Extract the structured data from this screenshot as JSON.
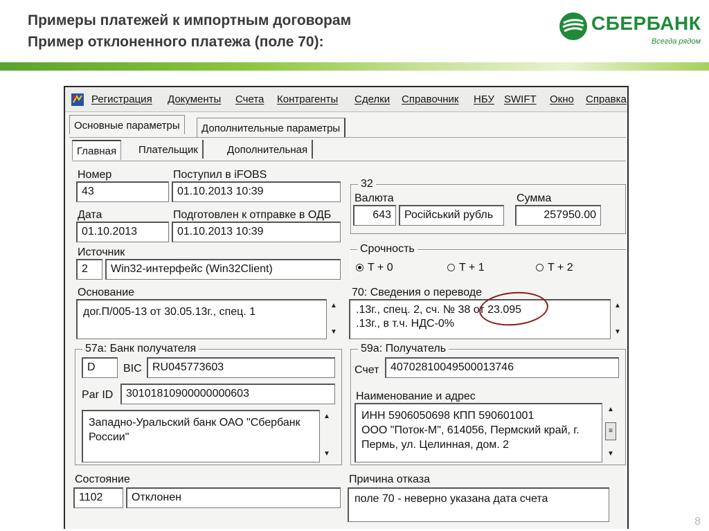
{
  "slide": {
    "title_line1": "Примеры платежей к импортным договорам",
    "title_line2": "Пример отклоненного платежа (поле 70):",
    "page_number": "8"
  },
  "brand": {
    "name": "СБЕРБАНК",
    "slogan": "Всегда рядом",
    "color": "#1f8a3a"
  },
  "menu": [
    "Регистрация",
    "Документы",
    "Счета",
    "Контрагенты",
    "Сделки",
    "Справочник",
    "НБУ",
    "SWIFT",
    "Окно",
    "Справка"
  ],
  "tabs_top": [
    "Основные параметры",
    "Дополнительные параметры"
  ],
  "tabs_sub": [
    "Главная",
    "Плательщик",
    "Дополнительная"
  ],
  "fields": {
    "number_label": "Номер",
    "number_value": "43",
    "received_label": "Поступил в iFOBS",
    "received_value": "01.10.2013 10:39",
    "date_label": "Дата",
    "date_value": "01.10.2013",
    "prepared_label": "Подготовлен к отправке в ОДБ",
    "prepared_value": "01.10.2013 10:39",
    "source_label": "Источник",
    "source_code": "2",
    "source_value": "Win32-интерфейс (Win32Client)",
    "basis_label": "Основание",
    "basis_value": "дог.П/005-13 от 30.05.13г., спец. 1",
    "group32_title": "32",
    "currency_label": "Валюта",
    "currency_code": "643",
    "currency_name": "Російський рубль",
    "amount_label": "Сумма",
    "amount_value": "257950.00",
    "urgency_title": "Срочность",
    "urgency_options": [
      "T + 0",
      "T + 1",
      "T + 2"
    ],
    "urgency_selected": "T + 0",
    "field70_label": "70: Сведения о переводе",
    "field70_line1": ".13г., спец. 2, сч. № 38  от 23.095",
    "field70_line2": ".13г., в т.ч.  НДС-0%",
    "bank57_title": "57а: Банк получателя",
    "bank57_code": "D",
    "bic_label": "BIC",
    "bic_value": "RU045773603",
    "parid_label": "Par ID",
    "parid_value": "30101810900000000603",
    "bank57_name": "Западно-Уральский банк ОАО \"Сбербанк России\"",
    "recv59_title": "59а: Получатель",
    "account_label": "Счет",
    "account_value": "40702810049500013746",
    "name_addr_label": "Наименование и адрес",
    "name_addr_line1": "ИНН 5906050698 КПП 590601001",
    "name_addr_line2": "ООО \"Поток-М\", 614056, Пермский край, г. Пермь, ул. Целинная, дом. 2",
    "state_label": "Состояние",
    "state_code": "1102",
    "state_value": "Отклонен",
    "reject_label": "Причина отказа",
    "reject_value": "поле 70 - неверно указана дата счета"
  }
}
